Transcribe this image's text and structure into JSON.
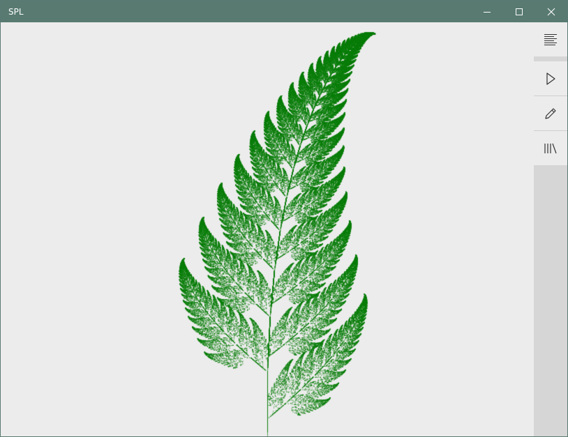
{
  "window": {
    "title": "SPL"
  },
  "titlebar": {
    "minimize_icon": "minimize-icon",
    "maximize_icon": "maximize-icon",
    "close_icon": "close-icon"
  },
  "sidebar": {
    "items": [
      {
        "name": "align-text-icon"
      },
      {
        "name": "play-icon"
      },
      {
        "name": "pencil-icon"
      },
      {
        "name": "library-icon"
      }
    ]
  },
  "colors": {
    "titlebar": "#587a71",
    "canvas": "#ececec",
    "fern": "#0a7d0a",
    "sidebar": "#d6d6d6"
  }
}
